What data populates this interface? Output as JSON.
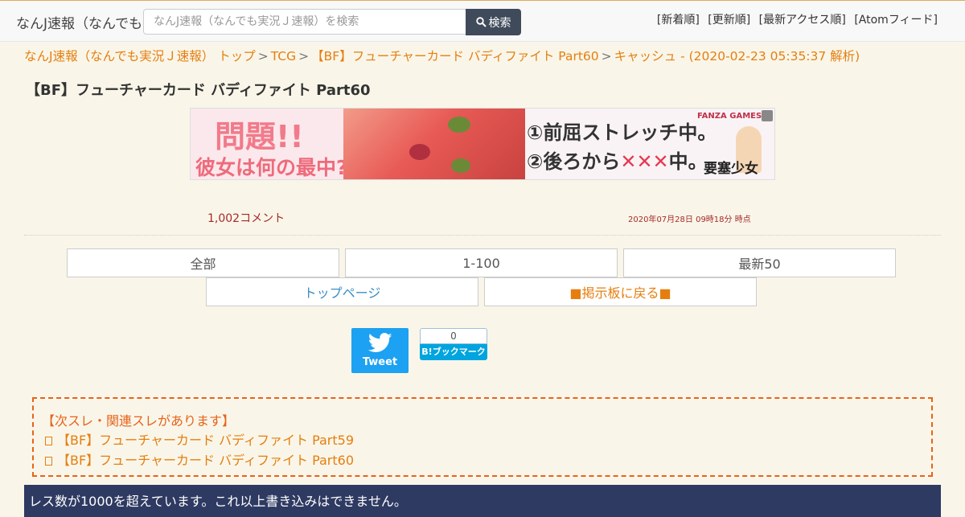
{
  "header": {
    "site_name": "なんJ速報（なんでも実況Ｊ速報）",
    "search_placeholder": "なんJ速報（なんでも実況Ｊ速報）を検索",
    "search_button": "検索",
    "nav": [
      "[新着順]",
      "[更新順]",
      "[最新アクセス順]",
      "[Atomフィード]"
    ]
  },
  "breadcrumb": {
    "items": [
      "なんJ速報（なんでも実況Ｊ速報） トップ",
      "TCG",
      "【BF】フューチャーカード バディファイト Part60",
      "キャッシュ - (2020-02-23 05:35:37 解析)"
    ],
    "separator": ">"
  },
  "thread": {
    "title": "【BF】フューチャーカード バディファイト Part60",
    "comment_count": "1,002コメント",
    "timestamp": "2020年07月28日 09時18分 時点"
  },
  "banner": {
    "headline": "問題!!",
    "subheadline": "彼女は何の最中?",
    "line1": "①前屈ストレッチ中。",
    "line2_prefix": "②後ろから",
    "line2_marks": "✕✕✕",
    "line2_suffix": "中。",
    "brand": "FANZA GAMES",
    "game": "要塞少女"
  },
  "buttons": {
    "all": "全部",
    "range": "1-100",
    "latest": "最新50",
    "top_page": "トップページ",
    "back_board": "■掲示板に戻る■"
  },
  "share": {
    "tweet": "Tweet",
    "hatena_count": "0",
    "hatena_label": "B!ブックマーク"
  },
  "related": {
    "heading": "【次スレ・関連スレがあります】",
    "items": [
      "【BF】フューチャーカード バディファイト Part59",
      "【BF】フューチャーカード バディファイト Part60"
    ]
  },
  "notice": "レス数が1000を超えています。これ以上書き込みはできません。",
  "colors": {
    "accent": "#e67e0f",
    "link_blue": "#3a8fc4",
    "notice_bg": "#2e3a61",
    "tweet_bg": "#1da1f2"
  }
}
